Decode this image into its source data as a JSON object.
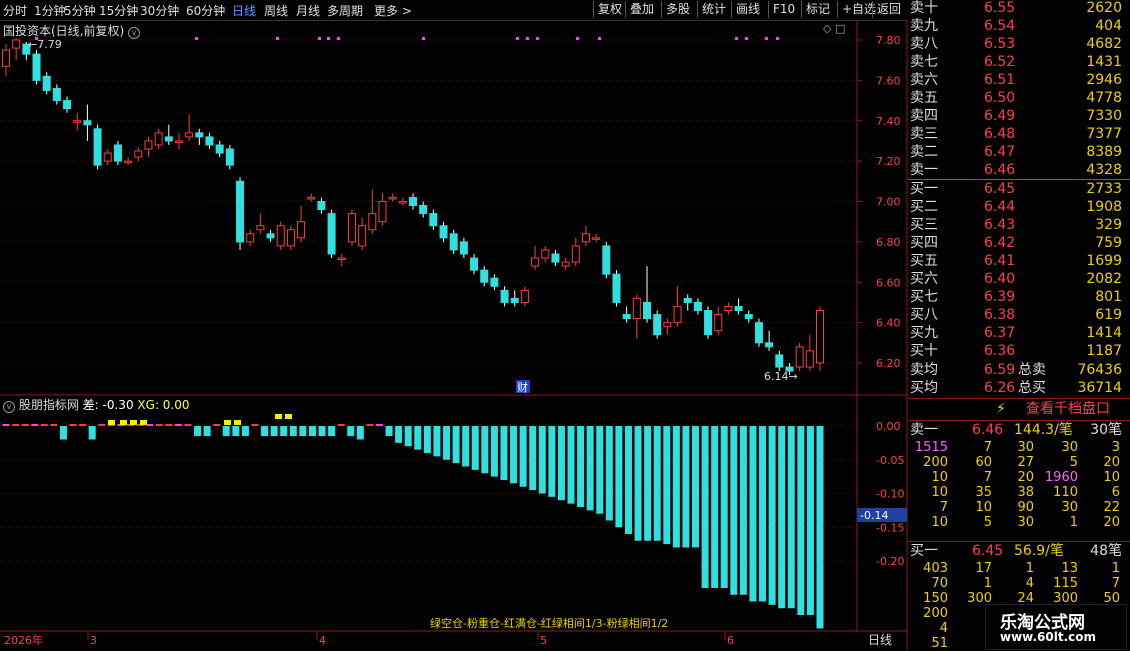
{
  "toolbar": {
    "tabs": [
      "分时",
      "1分钟",
      "5分钟",
      "15分钟",
      "30分钟",
      "60分钟",
      "日线",
      "周线",
      "月线",
      "多周期",
      "更多 >"
    ],
    "active_tab": "日线",
    "buttons": [
      "复权",
      "叠加",
      "多股",
      "统计",
      "画线",
      "F10",
      "标记",
      "+自选",
      "返回"
    ]
  },
  "main_chart": {
    "title": "国投资本(日线,前复权)",
    "high_label": "7.79",
    "low_label": "6.14",
    "event_marker": "财",
    "y_ticks": [
      "7.80",
      "7.60",
      "7.40",
      "7.20",
      "7.00",
      "6.80",
      "6.60",
      "6.40",
      "6.20"
    ]
  },
  "indicator": {
    "title": "股朋指标网",
    "diff_label": "差: -0.30",
    "xg_label": "XG: 0.00",
    "current_value": "-0.14",
    "y_ticks": [
      "0.00",
      "-0.05",
      "-0.10",
      "-0.15",
      "-0.20"
    ],
    "legend_text": "绿空仓-粉重仓-红满仓-红绿相间1/3-粉绿相间1/2"
  },
  "timeline": {
    "year_label": "2026年",
    "month_labels": [
      "3",
      "4",
      "5",
      "6"
    ],
    "period_label": "日线"
  },
  "order_book": {
    "asks": [
      {
        "label": "卖十",
        "price": "6.55",
        "vol": "2620"
      },
      {
        "label": "卖九",
        "price": "6.54",
        "vol": "404"
      },
      {
        "label": "卖八",
        "price": "6.53",
        "vol": "4682"
      },
      {
        "label": "卖七",
        "price": "6.52",
        "vol": "1431"
      },
      {
        "label": "卖六",
        "price": "6.51",
        "vol": "2946"
      },
      {
        "label": "卖五",
        "price": "6.50",
        "vol": "4778"
      },
      {
        "label": "卖四",
        "price": "6.49",
        "vol": "7330"
      },
      {
        "label": "卖三",
        "price": "6.48",
        "vol": "7377"
      },
      {
        "label": "卖二",
        "price": "6.47",
        "vol": "8389"
      },
      {
        "label": "卖一",
        "price": "6.46",
        "vol": "4328"
      }
    ],
    "bids": [
      {
        "label": "买一",
        "price": "6.45",
        "vol": "2733"
      },
      {
        "label": "买二",
        "price": "6.44",
        "vol": "1908"
      },
      {
        "label": "买三",
        "price": "6.43",
        "vol": "329"
      },
      {
        "label": "买四",
        "price": "6.42",
        "vol": "759"
      },
      {
        "label": "买五",
        "price": "6.41",
        "vol": "1699"
      },
      {
        "label": "买六",
        "price": "6.40",
        "vol": "2082"
      },
      {
        "label": "买七",
        "price": "6.39",
        "vol": "801"
      },
      {
        "label": "买八",
        "price": "6.38",
        "vol": "619"
      },
      {
        "label": "买九",
        "price": "6.37",
        "vol": "1414"
      },
      {
        "label": "买十",
        "price": "6.36",
        "vol": "1187"
      }
    ],
    "avg_sell": {
      "label": "卖均",
      "price": "6.59",
      "total_label": "总卖",
      "total": "76436"
    },
    "avg_buy": {
      "label": "买均",
      "price": "6.26",
      "total_label": "总买",
      "total": "36714"
    }
  },
  "queue": {
    "button_label": "查看千档盘口",
    "sell1": {
      "label": "卖一",
      "price": "6.46",
      "per": "144.3/笔",
      "count": "30笔"
    },
    "sell_rows": [
      [
        "1515",
        "7",
        "30",
        "30",
        "3"
      ],
      [
        "200",
        "60",
        "27",
        "5",
        "20"
      ],
      [
        "10",
        "7",
        "20",
        "1960",
        "10"
      ],
      [
        "10",
        "35",
        "38",
        "110",
        "6"
      ],
      [
        "7",
        "10",
        "90",
        "30",
        "22"
      ],
      [
        "10",
        "5",
        "30",
        "1",
        "20"
      ]
    ],
    "buy1": {
      "label": "买一",
      "price": "6.45",
      "per": "56.9/笔",
      "count": "48笔"
    },
    "buy_rows": [
      [
        "403",
        "17",
        "1",
        "13",
        "1"
      ],
      [
        "70",
        "1",
        "4",
        "115",
        "7"
      ],
      [
        "150",
        "300",
        "24",
        "300",
        "50"
      ],
      [
        "200",
        "",
        "",
        "",
        ""
      ],
      [
        "4",
        "",
        "",
        "",
        ""
      ],
      [
        "51",
        "",
        "",
        "",
        ""
      ]
    ]
  },
  "watermark": {
    "title": "乐淘公式网",
    "url": "www.60lt.com"
  },
  "colors": {
    "up": "#ff3c3c",
    "down": "#30e0e0",
    "pink": "#ff3cff",
    "yellow": "#f0f000"
  }
}
